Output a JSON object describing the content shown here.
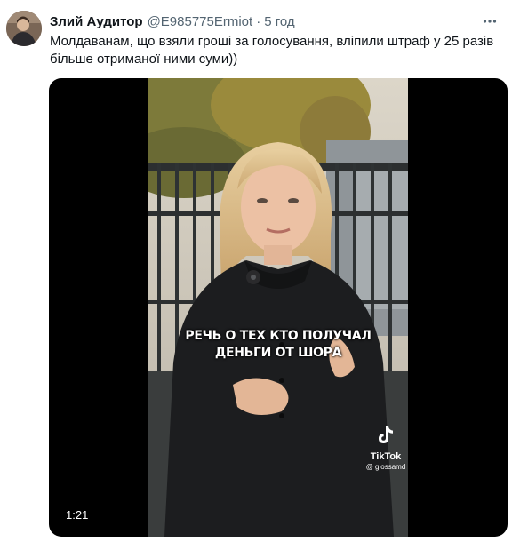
{
  "tweet": {
    "author_name": "Злий Аудитор",
    "author_handle": "@E985775Ermiot",
    "separator": "·",
    "time": "5 год",
    "more_label": "···",
    "text": "Молдаванам, що взяли гроші за голосування, вліпили штраф у 25 разів більше отриманої ними суми))"
  },
  "video": {
    "caption_line1": "РЕЧЬ О ТЕХ КТО ПОЛУЧАЛ",
    "caption_line2": "ДЕНЬГИ ОТ ШОРА",
    "watermark_brand": "TikTok",
    "watermark_user": "@ glossamd",
    "duration": "1:21"
  },
  "icons": {
    "more": "more-horizontal-icon",
    "tiktok": "tiktok-logo-icon"
  },
  "colors": {
    "text": "#0f1419",
    "secondary": "#536471",
    "media_bg": "#000000"
  }
}
